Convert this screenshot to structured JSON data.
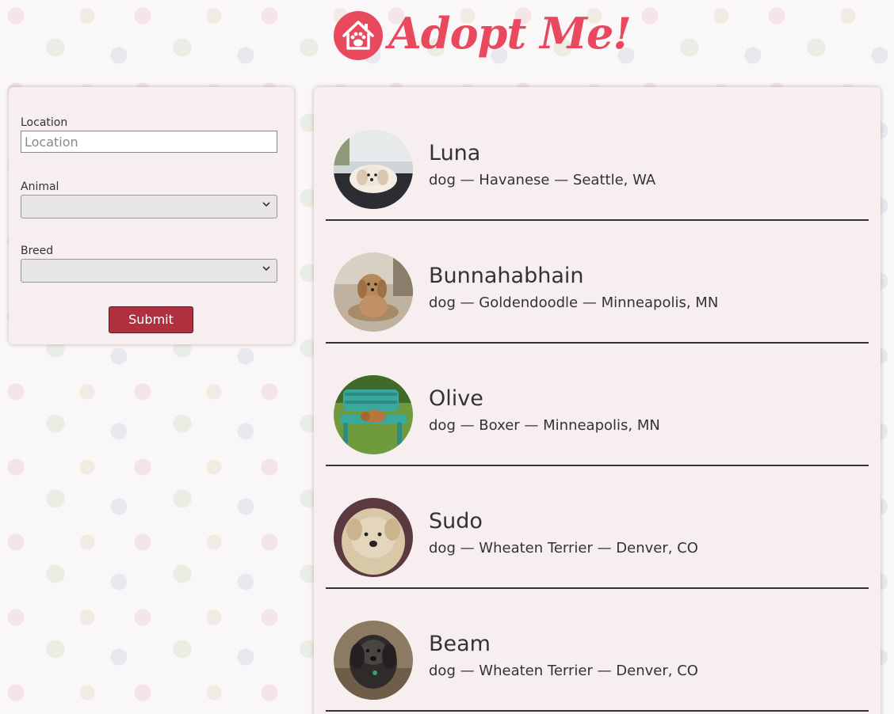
{
  "header": {
    "title": "Adopt Me!",
    "logo_icon": "house-paw-icon",
    "brand_color": "#e8495c"
  },
  "search": {
    "location_label": "Location",
    "location_placeholder": "Location",
    "location_value": "",
    "animal_label": "Animal",
    "animal_selected": "",
    "breed_label": "Breed",
    "breed_selected": "",
    "submit_label": "Submit",
    "submit_color": "#b0303f"
  },
  "pets": [
    {
      "name": "Luna",
      "info": "dog — Havanese — Seattle, WA"
    },
    {
      "name": "Bunnahabhain",
      "info": "dog — Goldendoodle — Minneapolis, MN"
    },
    {
      "name": "Olive",
      "info": "dog — Boxer — Minneapolis, MN"
    },
    {
      "name": "Sudo",
      "info": "dog — Wheaten Terrier — Denver, CO"
    },
    {
      "name": "Beam",
      "info": "dog — Wheaten Terrier — Denver, CO"
    }
  ]
}
